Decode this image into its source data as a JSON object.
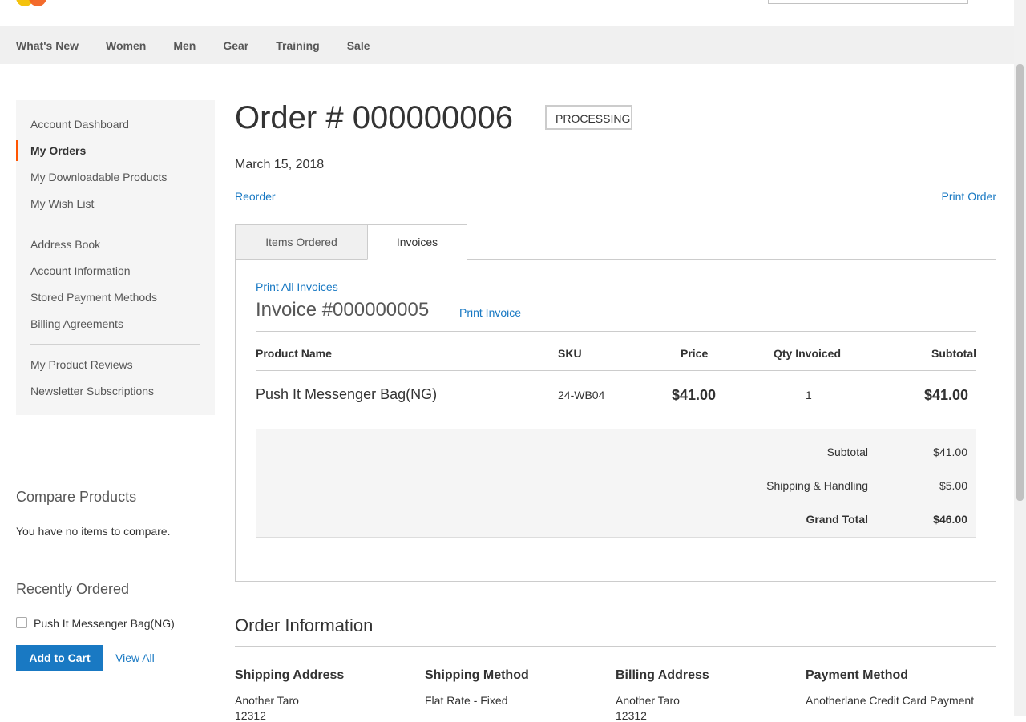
{
  "nav": {
    "items": [
      "What's New",
      "Women",
      "Men",
      "Gear",
      "Training",
      "Sale"
    ]
  },
  "sidebar": {
    "items": [
      "Account Dashboard",
      "My Orders",
      "My Downloadable Products",
      "My Wish List",
      "Address Book",
      "Account Information",
      "Stored Payment Methods",
      "Billing Agreements",
      "My Product Reviews",
      "Newsletter Subscriptions"
    ]
  },
  "compare": {
    "title": "Compare Products",
    "empty_text": "You have no items to compare."
  },
  "recently_ordered": {
    "title": "Recently Ordered",
    "item": "Push It Messenger Bag(NG)",
    "add_to_cart": "Add to Cart",
    "view_all": "View All"
  },
  "order": {
    "title": "Order # 000000006",
    "status": "PROCESSING",
    "date": "March 15, 2018",
    "reorder": "Reorder",
    "print_order": "Print Order"
  },
  "tabs": {
    "items_ordered": "Items Ordered",
    "invoices": "Invoices"
  },
  "invoice": {
    "print_all": "Print All Invoices",
    "title": "Invoice #000000005",
    "print_invoice": "Print Invoice",
    "columns": {
      "product": "Product Name",
      "sku": "SKU",
      "price": "Price",
      "qty": "Qty Invoiced",
      "subtotal": "Subtotal"
    },
    "row": {
      "product": "Push It Messenger Bag(NG)",
      "sku": "24-WB04",
      "price": "$41.00",
      "qty": "1",
      "subtotal": "$41.00"
    },
    "totals": {
      "subtotal_label": "Subtotal",
      "subtotal_value": "$41.00",
      "shipping_label": "Shipping & Handling",
      "shipping_value": "$5.00",
      "grand_label": "Grand Total",
      "grand_value": "$46.00"
    }
  },
  "order_info": {
    "title": "Order Information",
    "shipping_address": {
      "heading": "Shipping Address",
      "name": "Another Taro",
      "line2": "12312"
    },
    "shipping_method": {
      "heading": "Shipping Method",
      "value": "Flat Rate - Fixed"
    },
    "billing_address": {
      "heading": "Billing Address",
      "name": "Another Taro",
      "line2": "12312"
    },
    "payment_method": {
      "heading": "Payment Method",
      "value": "Anotherlane Credit Card Payment"
    }
  }
}
